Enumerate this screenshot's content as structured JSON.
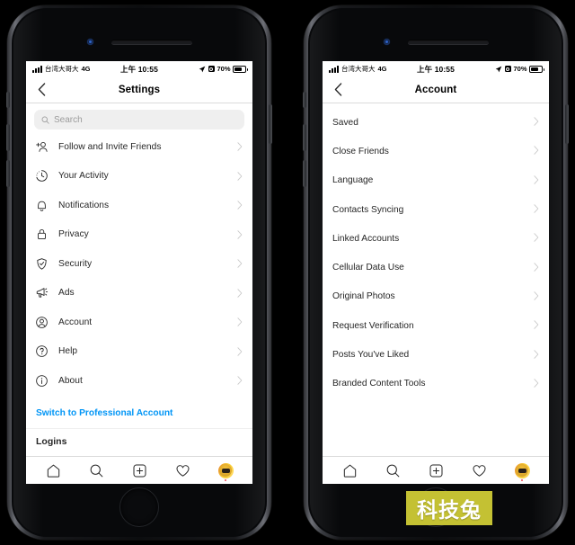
{
  "statusbar": {
    "carrier": "台湾大哥大",
    "network": "4G",
    "time": "上午 10:55",
    "battery_percent": "70%"
  },
  "left_phone": {
    "nav": {
      "title": "Settings",
      "back_icon": "chevron-left-icon"
    },
    "search": {
      "placeholder": "Search",
      "icon": "search-icon"
    },
    "items": [
      {
        "label": "Follow and Invite Friends",
        "icon": "person-add-icon"
      },
      {
        "label": "Your Activity",
        "icon": "clock-activity-icon"
      },
      {
        "label": "Notifications",
        "icon": "bell-icon"
      },
      {
        "label": "Privacy",
        "icon": "lock-icon"
      },
      {
        "label": "Security",
        "icon": "shield-check-icon"
      },
      {
        "label": "Ads",
        "icon": "megaphone-icon"
      },
      {
        "label": "Account",
        "icon": "person-circle-icon"
      },
      {
        "label": "Help",
        "icon": "question-circle-icon"
      },
      {
        "label": "About",
        "icon": "info-circle-icon"
      }
    ],
    "switch_professional": "Switch to Professional Account",
    "logins_header": "Logins"
  },
  "right_phone": {
    "nav": {
      "title": "Account",
      "back_icon": "chevron-left-icon"
    },
    "items": [
      {
        "label": "Saved"
      },
      {
        "label": "Close Friends"
      },
      {
        "label": "Language"
      },
      {
        "label": "Contacts Syncing"
      },
      {
        "label": "Linked Accounts"
      },
      {
        "label": "Cellular Data Use"
      },
      {
        "label": "Original Photos"
      },
      {
        "label": "Request Verification"
      },
      {
        "label": "Posts You've Liked"
      },
      {
        "label": "Branded Content Tools"
      }
    ]
  },
  "tabbar": {
    "items": [
      {
        "name": "home-tab",
        "icon": "home-icon"
      },
      {
        "name": "search-tab",
        "icon": "search-icon"
      },
      {
        "name": "create-tab",
        "icon": "plus-square-icon"
      },
      {
        "name": "activity-tab",
        "icon": "heart-icon"
      },
      {
        "name": "profile-tab",
        "icon": "avatar-icon"
      }
    ]
  },
  "watermark": {
    "text": "科技兔",
    "bg": "#c4c133"
  },
  "colors": {
    "link": "#0095f6",
    "text": "#262626",
    "divider": "#dbdbdb",
    "search_bg": "#efefef"
  }
}
